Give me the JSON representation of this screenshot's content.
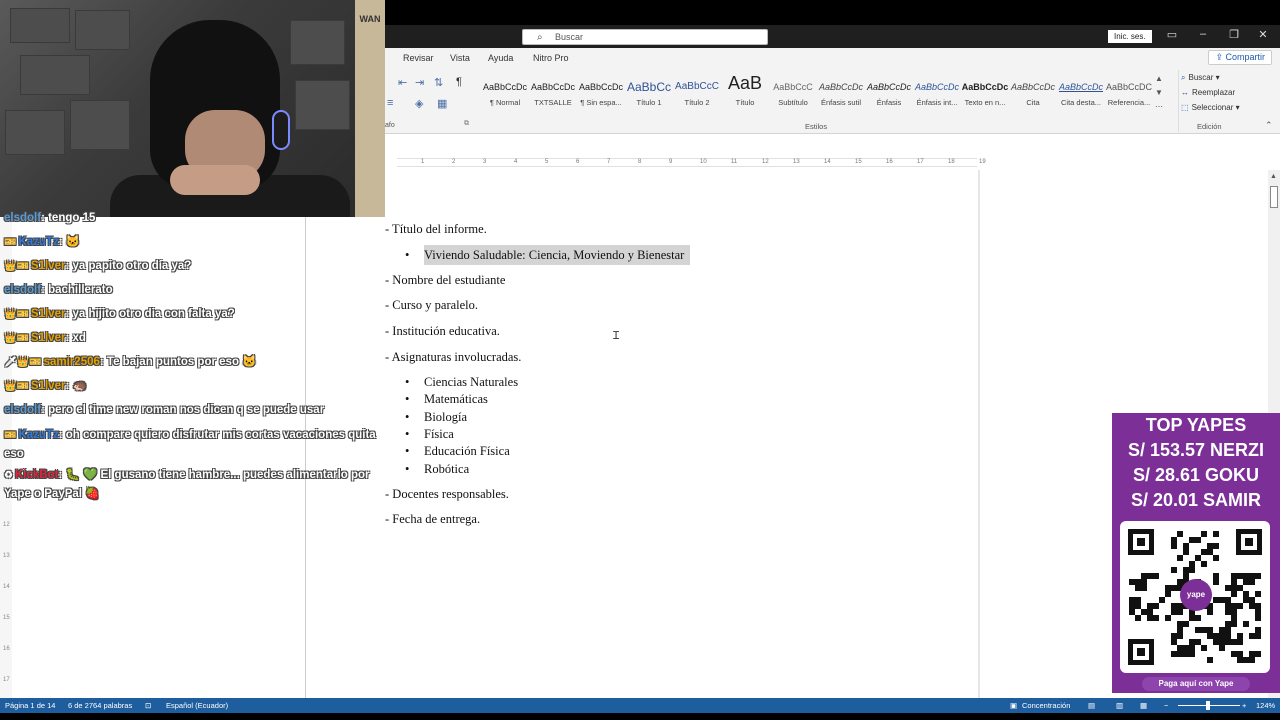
{
  "titlebar": {
    "search_placeholder": "Buscar",
    "signin_label": "Inic. ses.",
    "window_controls": [
      "ribbon-display-icon",
      "minimize-icon",
      "restore-icon",
      "close-icon"
    ]
  },
  "ribbon": {
    "tabs": [
      "Revisar",
      "Vista",
      "Ayuda",
      "Nitro Pro"
    ],
    "share_label": "Compartir",
    "paragraph_caption": "afo",
    "styles": [
      {
        "preview": "AaBbCcDc",
        "label": "¶ Normal"
      },
      {
        "preview": "AaBbCcDc",
        "label": "TXTSALLE"
      },
      {
        "preview": "AaBbCcDc",
        "label": "¶ Sin espa..."
      },
      {
        "preview": "AaBbCc",
        "label": "Título 1"
      },
      {
        "preview": "AaBbCcC",
        "label": "Título 2"
      },
      {
        "preview": "AaB",
        "label": "Título"
      },
      {
        "preview": "AaBbCcC",
        "label": "Subtítulo"
      },
      {
        "preview": "AaBbCcDc",
        "label": "Énfasis sutil"
      },
      {
        "preview": "AaBbCcDc",
        "label": "Énfasis"
      },
      {
        "preview": "AaBbCcDc",
        "label": "Énfasis int..."
      },
      {
        "preview": "AaBbCcDc",
        "label": "Texto en n..."
      },
      {
        "preview": "AaBbCcDc",
        "label": "Cita"
      },
      {
        "preview": "AaBbCcDc",
        "label": "Cita desta..."
      },
      {
        "preview": "AaBbCcDC",
        "label": "Referencia..."
      }
    ],
    "styles_caption": "Estilos",
    "edit": {
      "find": "Buscar",
      "replace": "Reemplazar",
      "select": "Seleccionar",
      "caption": "Edición"
    }
  },
  "ruler": {
    "ticks": [
      "1",
      "2",
      "3",
      "4",
      "5",
      "6",
      "7",
      "8",
      "9",
      "10",
      "11",
      "12",
      "13",
      "14",
      "15",
      "16",
      "17",
      "18",
      "19"
    ]
  },
  "document": {
    "lines": [
      {
        "kind": "dash",
        "text": "- Título del informe."
      },
      {
        "kind": "bullet",
        "text": "Viviendo Saludable: Ciencia, Moviendo y Bienestar",
        "highlighted": true
      },
      {
        "kind": "dash",
        "text": "- Nombre del estudiante"
      },
      {
        "kind": "dash",
        "text": "- Curso y paralelo."
      },
      {
        "kind": "dash",
        "text": "- Institución educativa."
      },
      {
        "kind": "dash",
        "text": "- Asignaturas involucradas."
      },
      {
        "kind": "bullet",
        "text": "Ciencias Naturales"
      },
      {
        "kind": "bullet",
        "text": "Matemáticas"
      },
      {
        "kind": "bullet",
        "text": "Biología"
      },
      {
        "kind": "bullet",
        "text": "Física"
      },
      {
        "kind": "bullet",
        "text": "Educación Física"
      },
      {
        "kind": "bullet",
        "text": "Robótica"
      },
      {
        "kind": "dash",
        "text": "- Docentes responsables."
      },
      {
        "kind": "dash",
        "text": "- Fecha de entrega."
      }
    ]
  },
  "status_bar": {
    "page": "Página 1 de 14",
    "words": "6 de 2764 palabras",
    "language": "Español (Ecuador)",
    "focus": "Concentración",
    "zoom": "124%"
  },
  "left_ruler": [
    "12",
    "13",
    "14",
    "15",
    "16",
    "17"
  ],
  "webcam": {
    "poster_text": "WAN"
  },
  "chat": [
    {
      "user": "elsdolf",
      "text": "tengo 15",
      "color": "#5b9bd5",
      "badges": ""
    },
    {
      "user": "KazuTz",
      "text": "🐱",
      "color": "#2d7be0",
      "badges": "🎫"
    },
    {
      "user": "S1lver",
      "text": "ya papito otro día ya?",
      "color": "#e5a100",
      "badges": "👑🎫"
    },
    {
      "user": "elsdolf",
      "text": "bachillerato",
      "color": "#5b9bd5",
      "badges": ""
    },
    {
      "user": "S1lver",
      "text": "ya hijito otro dia con falta ya?",
      "color": "#e5a100",
      "badges": "👑🎫"
    },
    {
      "user": "S1lver",
      "text": "xd",
      "color": "#e5a100",
      "badges": "👑🎫"
    },
    {
      "user": "samir2506",
      "text": "Te bajan puntos por eso 🐱",
      "color": "#e5a100",
      "badges": "🗡👑🎫"
    },
    {
      "user": "S1lver",
      "text": "🦔",
      "color": "#e5a100",
      "badges": "👑🎫"
    },
    {
      "user": "elsdolf",
      "text": "pero el time new roman nos dicen q se puede usar",
      "color": "#5b9bd5",
      "badges": ""
    },
    {
      "user": "KazuTz",
      "text": "oh compare quiero disfrutar mis cortas vacaciones quita eso",
      "color": "#2d7be0",
      "badges": "🎫"
    },
    {
      "user": "KickBot",
      "text": "🐛 💚 El gusano tiene hambre... puedes alimentarlo por Yape o PayPal 🍓",
      "color": "#e0243c",
      "badges": "♻"
    }
  ],
  "yape": {
    "title": "TOP YAPES",
    "donors": [
      "S/ 153.57 NERZI",
      "S/ 28.61 GOKU",
      "S/ 20.01 SAMIR"
    ],
    "qr_logo": "yape",
    "button": "Paga aquí con Yape"
  }
}
